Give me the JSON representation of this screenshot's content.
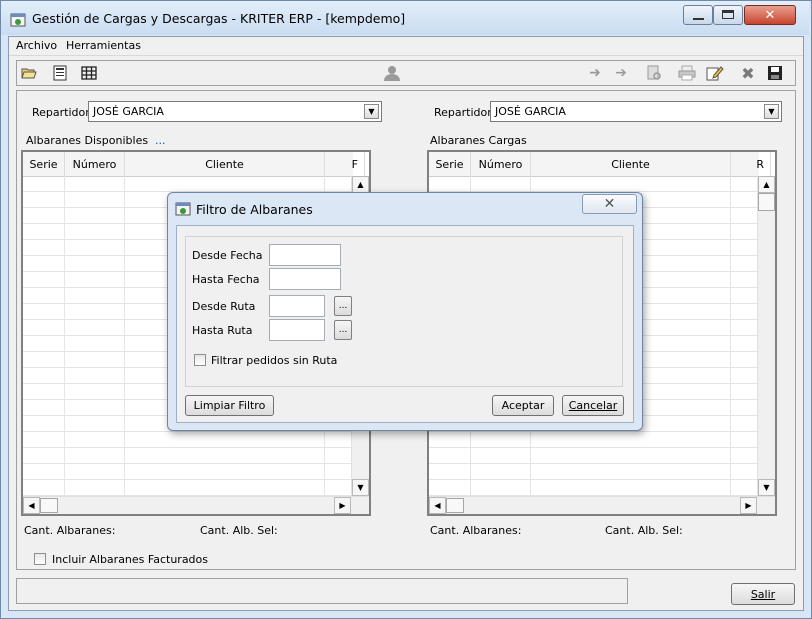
{
  "window": {
    "title": "Gestión de Cargas y Descargas - KRITER ERP -  [kempdemo]"
  },
  "menu": {
    "items": [
      "Archivo",
      "Herramientas"
    ]
  },
  "toolbar": {
    "icons": [
      "open-folder-icon",
      "form-icon",
      "grid-icon",
      "user-icon",
      "arrow-right-icon",
      "double-arrow-icon",
      "report-icon",
      "print-icon",
      "edit-icon",
      "delete-icon",
      "save-icon"
    ]
  },
  "left_panel": {
    "repartidor_label": "Repartidor",
    "repartidor_value": "JOSÉ GARCIA",
    "section_label": "Albaranes Disponibles",
    "ellipsis": "...",
    "columns": [
      "Serie",
      "Número",
      "Cliente",
      "F"
    ],
    "cant_albaranes": "Cant. Albaranes:",
    "cant_alb_sel": "Cant. Alb. Sel:"
  },
  "right_panel": {
    "repartidor_label": "Repartidor",
    "repartidor_value": "JOSÉ GARCIA",
    "section_label": "Albaranes Cargas",
    "columns": [
      "Serie",
      "Número",
      "Cliente",
      "R"
    ],
    "cant_albaranes": "Cant. Albaranes:",
    "cant_alb_sel": "Cant. Alb. Sel:"
  },
  "incluir_label": "Incluir Albaranes Facturados",
  "salir_button": "Salir",
  "dialog": {
    "title": "Filtro de Albaranes",
    "desde_fecha": "Desde Fecha",
    "hasta_fecha": "Hasta Fecha",
    "desde_ruta": "Desde Ruta",
    "hasta_ruta": "Hasta Ruta",
    "ellipsis": "...",
    "filtrar_label": "Filtrar pedidos sin Ruta",
    "limpiar_button": "Limpiar Filtro",
    "aceptar_button": "Aceptar",
    "cancelar_button": "Cancelar"
  }
}
